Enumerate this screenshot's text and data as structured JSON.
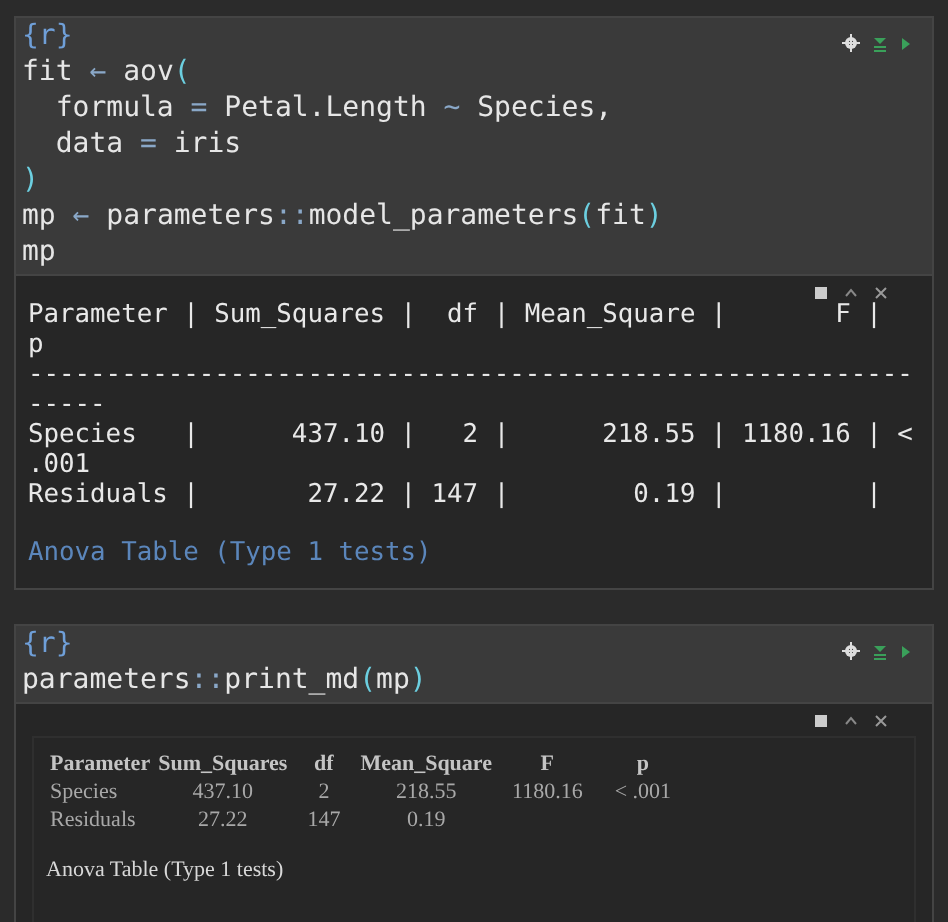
{
  "chunks": [
    {
      "header": "{r}",
      "code": [
        [
          {
            "text": "fit ",
            "kind": "plain"
          },
          {
            "text": "←",
            "kind": "op"
          },
          {
            "text": " aov",
            "kind": "plain"
          },
          {
            "text": "(",
            "kind": "paren"
          }
        ],
        [
          {
            "text": "  formula ",
            "kind": "plain"
          },
          {
            "text": "=",
            "kind": "op"
          },
          {
            "text": " Petal.Length ",
            "kind": "plain"
          },
          {
            "text": "~",
            "kind": "op"
          },
          {
            "text": " Species,",
            "kind": "plain"
          }
        ],
        [
          {
            "text": "  data ",
            "kind": "plain"
          },
          {
            "text": "=",
            "kind": "op"
          },
          {
            "text": " iris",
            "kind": "plain"
          }
        ],
        [
          {
            "text": ")",
            "kind": "paren"
          }
        ],
        [
          {
            "text": "mp ",
            "kind": "plain"
          },
          {
            "text": "←",
            "kind": "op"
          },
          {
            "text": " parameters",
            "kind": "plain"
          },
          {
            "text": "::",
            "kind": "op"
          },
          {
            "text": "model_parameters",
            "kind": "plain"
          },
          {
            "text": "(",
            "kind": "paren"
          },
          {
            "text": "fit",
            "kind": "plain"
          },
          {
            "text": ")",
            "kind": "paren"
          }
        ],
        [
          {
            "text": "mp",
            "kind": "plain"
          }
        ]
      ],
      "output": {
        "kind": "console",
        "lines": [
          "Parameter | Sum_Squares |  df | Mean_Square |       F |",
          "p",
          "---------------------------------------------------------",
          "-----",
          "Species   |      437.10 |   2 |      218.55 | 1180.16 | <",
          ".001",
          "Residuals |       27.22 | 147 |        0.19 |         |"
        ],
        "caption": "Anova Table (Type 1 tests)"
      }
    },
    {
      "header": "{r}",
      "code": [
        [
          {
            "text": "parameters",
            "kind": "plain"
          },
          {
            "text": "::",
            "kind": "op"
          },
          {
            "text": "print_md",
            "kind": "plain"
          },
          {
            "text": "(",
            "kind": "paren"
          },
          {
            "text": "mp",
            "kind": "plain"
          },
          {
            "text": ")",
            "kind": "paren"
          }
        ]
      ],
      "output": {
        "kind": "table",
        "columns": [
          "Parameter",
          "Sum_Squares",
          "df",
          "Mean_Square",
          "F",
          "p"
        ],
        "rows": [
          [
            "Species",
            "437.10",
            "2",
            "218.55",
            "1180.16",
            "< .001"
          ],
          [
            "Residuals",
            "27.22",
            "147",
            "0.19",
            "",
            ""
          ]
        ],
        "caption": "Anova Table (Type 1 tests)"
      }
    }
  ]
}
